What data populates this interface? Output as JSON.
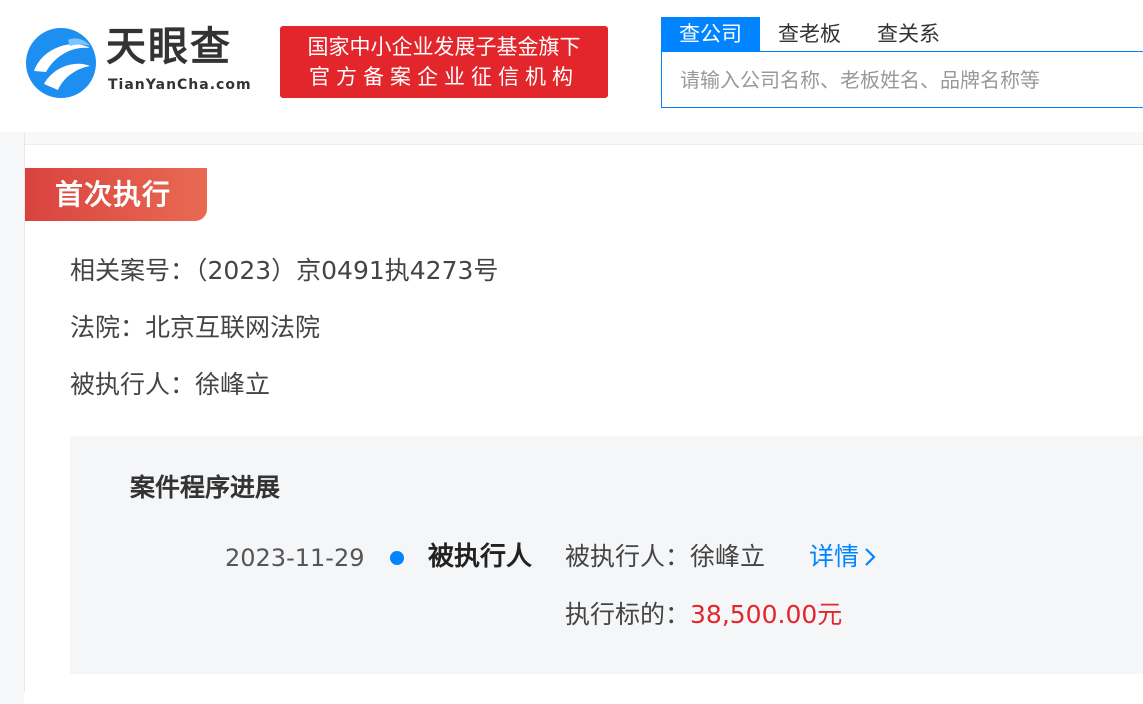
{
  "header": {
    "logo_cn": "天眼查",
    "logo_en": "TianYanCha.com",
    "badge_line1": "国家中小企业发展子基金旗下",
    "badge_line2": "官方备案企业征信机构",
    "tabs": [
      {
        "label": "查公司",
        "active": true
      },
      {
        "label": "查老板",
        "active": false
      },
      {
        "label": "查关系",
        "active": false
      }
    ],
    "search_placeholder": "请输入公司名称、老板姓名、品牌名称等",
    "search_value": ""
  },
  "section": {
    "tag": "首次执行",
    "case_no_label": "相关案号：",
    "case_no_value": "（2023）京0491执4273号",
    "court_label": "法院：",
    "court_value": "北京互联网法院",
    "executee_label": "被执行人：",
    "executee_value": "徐峰立"
  },
  "progress": {
    "title": "案件程序进展",
    "items": [
      {
        "date": "2023-11-29",
        "role": "被执行人",
        "executee_label": "被执行人：",
        "executee_value": "徐峰立",
        "detail_label": "详情",
        "subject_label": "执行标的：",
        "subject_value": "38,500.00元"
      }
    ]
  },
  "colors": {
    "brand_blue": "#0084ff",
    "badge_red": "#e2262b",
    "tag_red": "#d9433f",
    "amount_red": "#e2262b"
  },
  "icons": [
    "tianyancha-logo-icon",
    "chevron-right-icon",
    "timeline-dot-icon"
  ]
}
